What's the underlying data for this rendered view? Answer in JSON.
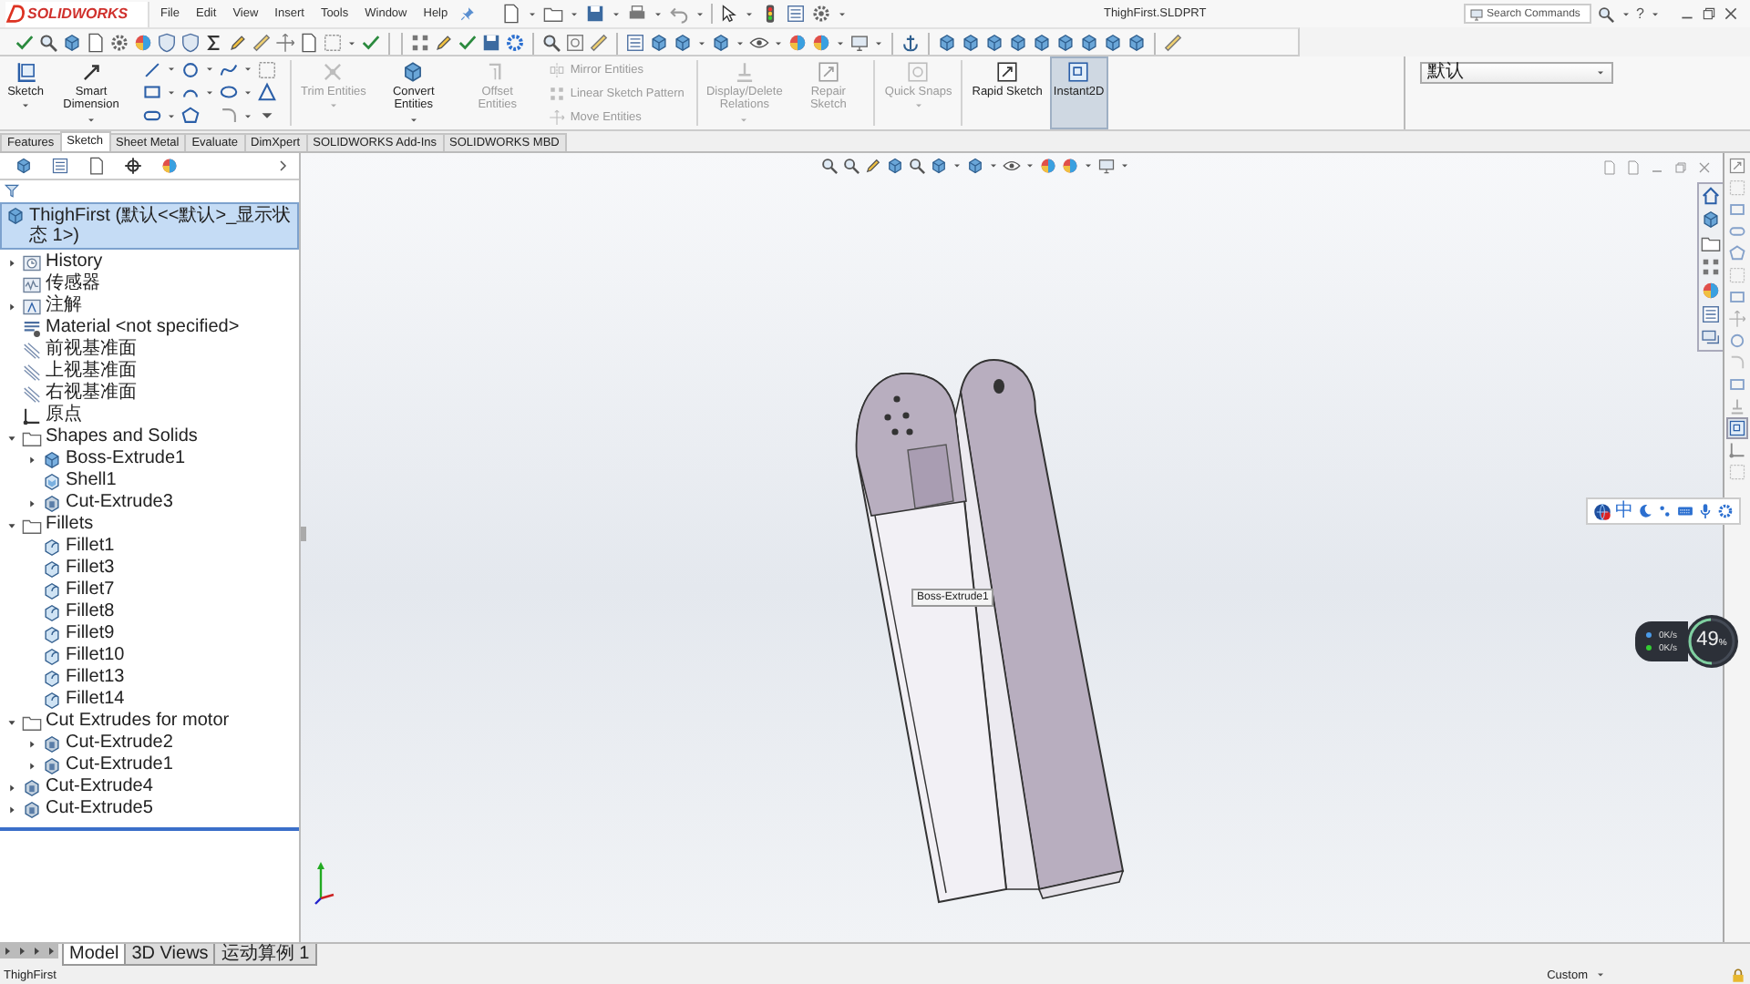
{
  "app": {
    "logo": "SOLIDWORKS",
    "menus": [
      "File",
      "Edit",
      "View",
      "Insert",
      "Tools",
      "Window",
      "Help"
    ],
    "title": "ThighFirst.SLDPRT",
    "search": {
      "placeholder": "Search Commands"
    },
    "help": "?"
  },
  "ribbon": {
    "commands": [
      {
        "kind": "large",
        "label": "Sketch",
        "disabled": false,
        "on": false,
        "dropdown": true
      },
      {
        "kind": "large",
        "label": "Smart Dimension",
        "disabled": false,
        "on": false,
        "dropdown": true
      },
      {
        "kind": "palette"
      },
      {
        "kind": "large",
        "label": "Trim Entities",
        "disabled": true,
        "on": false,
        "dropdown": true
      },
      {
        "kind": "large",
        "label": "Convert Entities",
        "disabled": false,
        "on": false,
        "dropdown": true
      },
      {
        "kind": "large",
        "label": "Offset Entities",
        "disabled": true,
        "on": false,
        "dropdown": false
      },
      {
        "kind": "small",
        "label": "Mirror Entities",
        "disabled": true,
        "on": false
      },
      {
        "kind": "small",
        "label": "Linear Sketch Pattern",
        "disabled": true,
        "on": false
      },
      {
        "kind": "small",
        "label": "Move Entities",
        "disabled": true,
        "on": false
      },
      {
        "kind": "large",
        "label": "Display/Delete Relations",
        "disabled": true,
        "on": false,
        "dropdown": true
      },
      {
        "kind": "large",
        "label": "Repair Sketch",
        "disabled": true,
        "on": false,
        "dropdown": false
      },
      {
        "kind": "large",
        "label": "Quick Snaps",
        "disabled": true,
        "on": false,
        "dropdown": true
      },
      {
        "kind": "large",
        "label": "Rapid Sketch",
        "disabled": false,
        "on": false,
        "dropdown": false
      },
      {
        "kind": "large",
        "label": "Instant2D",
        "disabled": false,
        "on": true,
        "dropdown": false
      }
    ],
    "configuration": "默认"
  },
  "command_tabs": [
    {
      "label": "Features",
      "selected": false
    },
    {
      "label": "Sketch",
      "selected": true
    },
    {
      "label": "Sheet Metal",
      "selected": false
    },
    {
      "label": "Evaluate",
      "selected": false
    },
    {
      "label": "DimXpert",
      "selected": false
    },
    {
      "label": "SOLIDWORKS Add-Ins",
      "selected": false
    },
    {
      "label": "SOLIDWORKS MBD",
      "selected": false
    }
  ],
  "feature_tree": {
    "root": {
      "label": "ThighFirst (默认<<默认>_显示状态 1>)",
      "selected": true
    },
    "items": [
      {
        "label": "History",
        "kind": "history",
        "selected": false,
        "expanded": false
      },
      {
        "label": "传感器",
        "kind": "sensor",
        "selected": false
      },
      {
        "label": "注解",
        "kind": "annotation",
        "selected": false,
        "expanded": false
      },
      {
        "label": "Material <not specified>",
        "kind": "material",
        "selected": false
      },
      {
        "label": "前视基准面",
        "kind": "plane",
        "selected": false
      },
      {
        "label": "上视基准面",
        "kind": "plane",
        "selected": false
      },
      {
        "label": "右视基准面",
        "kind": "plane",
        "selected": false
      },
      {
        "label": "原点",
        "kind": "origin",
        "selected": false
      },
      {
        "label": "Shapes and Solids",
        "kind": "folder",
        "selected": false,
        "expanded": true,
        "children": [
          {
            "label": "Boss-Extrude1",
            "kind": "extrude",
            "selected": false,
            "expanded": false
          },
          {
            "label": "Shell1",
            "kind": "shell",
            "selected": false
          },
          {
            "label": "Cut-Extrude3",
            "kind": "cut",
            "selected": false,
            "expanded": false
          }
        ]
      },
      {
        "label": "Fillets",
        "kind": "folder",
        "selected": false,
        "expanded": true,
        "children": [
          {
            "label": "Fillet1",
            "kind": "fillet",
            "selected": false
          },
          {
            "label": "Fillet3",
            "kind": "fillet",
            "selected": false
          },
          {
            "label": "Fillet7",
            "kind": "fillet",
            "selected": false
          },
          {
            "label": "Fillet8",
            "kind": "fillet",
            "selected": false
          },
          {
            "label": "Fillet9",
            "kind": "fillet",
            "selected": false
          },
          {
            "label": "Fillet10",
            "kind": "fillet",
            "selected": false
          },
          {
            "label": "Fillet13",
            "kind": "fillet",
            "selected": false
          },
          {
            "label": "Fillet14",
            "kind": "fillet",
            "selected": false
          }
        ]
      },
      {
        "label": "Cut Extrudes for motor",
        "kind": "folder",
        "selected": false,
        "expanded": true,
        "children": [
          {
            "label": "Cut-Extrude2",
            "kind": "cut",
            "selected": false,
            "expanded": false
          },
          {
            "label": "Cut-Extrude1",
            "kind": "cut",
            "selected": false,
            "expanded": false
          }
        ]
      },
      {
        "label": "Cut-Extrude4",
        "kind": "cut",
        "selected": false,
        "expanded": false
      },
      {
        "label": "Cut-Extrude5",
        "kind": "cut",
        "selected": false,
        "expanded": false
      }
    ]
  },
  "viewport": {
    "tooltip": "Boss-Extrude1",
    "ime_label": "中",
    "speed_meter": {
      "value": "49",
      "unit": "%",
      "level": 0.49,
      "upload": "0K/s",
      "download": "0K/s"
    }
  },
  "bottom_tabs": [
    {
      "label": "Model",
      "selected": true
    },
    {
      "label": "3D Views",
      "selected": false
    },
    {
      "label": "运动算例 1",
      "selected": false
    }
  ],
  "status_bar": {
    "document": "ThighFirst",
    "units": "Custom"
  }
}
